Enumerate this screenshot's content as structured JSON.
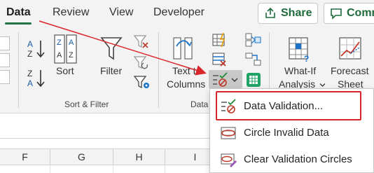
{
  "tabs": [
    {
      "label": "Data",
      "active": true
    },
    {
      "label": "Review",
      "active": false
    },
    {
      "label": "View",
      "active": false
    },
    {
      "label": "Developer",
      "active": false
    }
  ],
  "share": {
    "label": "Share"
  },
  "comments": {
    "label": "Comm"
  },
  "ribbon": {
    "sort_label": "Sort",
    "filter_label": "Filter",
    "sort_filter_group": "Sort & Filter",
    "text_to_columns_line1": "Text to",
    "text_to_columns_line2": "Columns",
    "data_tools_group": "Data",
    "whatif_line1": "What-If",
    "whatif_line2": "Analysis",
    "forecast_line1": "Forecast",
    "forecast_line2": "Sheet"
  },
  "dropdown": {
    "items": [
      {
        "label": "Data Validation...",
        "icon": "data-validation-icon",
        "highlighted": true
      },
      {
        "label": "Circle Invalid Data",
        "icon": "circle-invalid-data-icon",
        "highlighted": false
      },
      {
        "label": "Clear Validation Circles",
        "icon": "clear-validation-circles-icon",
        "highlighted": false
      }
    ]
  },
  "columns": [
    "F",
    "G",
    "H",
    "I"
  ],
  "colors": {
    "accent": "#217346",
    "highlight": "#d9262c",
    "arrow": "#d9262c"
  }
}
